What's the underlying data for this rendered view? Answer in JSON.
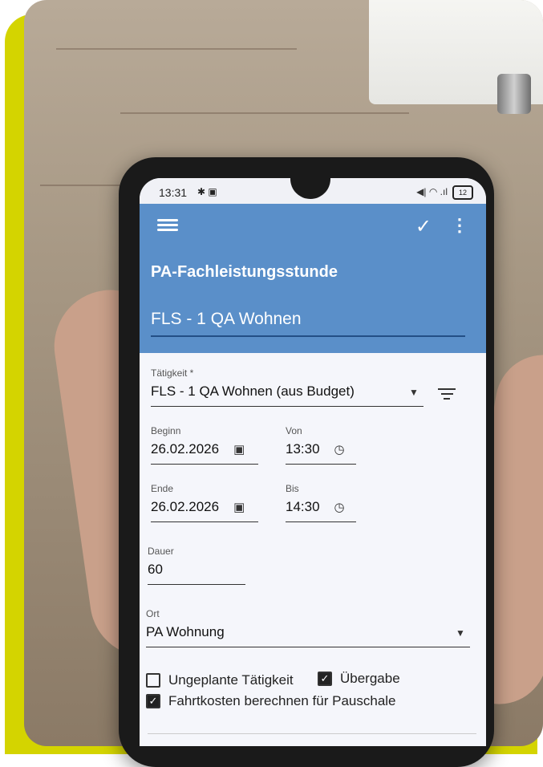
{
  "status": {
    "time": "13:31",
    "left_icons": "✱ ▣",
    "right_icons": "◀| ◠ .ıl",
    "battery": "12"
  },
  "appbar": {
    "title": "PA-Fachleistungsstunde",
    "subtitle": "FLS - 1 QA  Wohnen"
  },
  "form": {
    "taetigkeit": {
      "label": "Tätigkeit *",
      "value": "FLS - 1 QA Wohnen (aus Budget)"
    },
    "beginn": {
      "label": "Beginn",
      "value": "26.02.2026"
    },
    "von": {
      "label": "Von",
      "value": "13:30"
    },
    "ende": {
      "label": "Ende",
      "value": "26.02.2026"
    },
    "bis": {
      "label": "Bis",
      "value": "14:30"
    },
    "dauer": {
      "label": "Dauer",
      "value": "60"
    },
    "ort": {
      "label": "Ort",
      "value": "PA Wohnung"
    },
    "checkboxes": [
      {
        "label": "Ungeplante Tätigkeit",
        "checked": false
      },
      {
        "label": "Übergabe",
        "checked": true
      },
      {
        "label": "Fahrtkosten berechnen für Pauschale",
        "checked": true
      }
    ]
  },
  "colors": {
    "appbar": "#5a8fc9",
    "accent": "#d4d400"
  },
  "icons": [
    "menu-icon",
    "check-icon",
    "more-icon",
    "calendar-icon",
    "clock-icon",
    "filter-icon",
    "dropdown-arrow-icon"
  ]
}
